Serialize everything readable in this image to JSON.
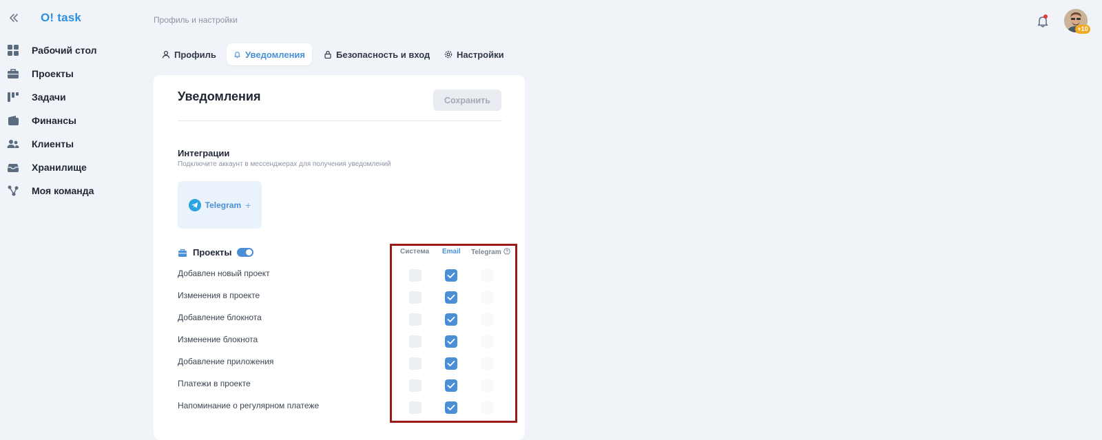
{
  "app": {
    "logo": "O! task"
  },
  "sidebar": {
    "items": [
      {
        "label": "Рабочий стол",
        "icon": "dashboard-icon"
      },
      {
        "label": "Проекты",
        "icon": "briefcase-icon"
      },
      {
        "label": "Задачи",
        "icon": "tasks-icon"
      },
      {
        "label": "Финансы",
        "icon": "wallet-icon"
      },
      {
        "label": "Клиенты",
        "icon": "users-icon"
      },
      {
        "label": "Хранилище",
        "icon": "storage-icon"
      },
      {
        "label": "Моя команда",
        "icon": "team-icon"
      }
    ]
  },
  "header": {
    "breadcrumb": "Профиль и настройки",
    "avatar_badge": "+10"
  },
  "tabs": [
    {
      "label": "Профиль",
      "icon": "user-icon",
      "active": false
    },
    {
      "label": "Уведомления",
      "icon": "bell-icon",
      "active": true
    },
    {
      "label": "Безопасность и вход",
      "icon": "lock-icon",
      "active": false
    },
    {
      "label": "Настройки",
      "icon": "gear-icon",
      "active": false
    }
  ],
  "notifications": {
    "title": "Уведомления",
    "save_label": "Сохранить",
    "integrations": {
      "title": "Интеграции",
      "subtitle": "Подключите аккаунт в мессенджерах для получения уведомлений",
      "telegram_label": "Telegram",
      "telegram_add": "+"
    },
    "projects": {
      "label": "Проекты",
      "enabled": true,
      "columns": [
        "Система",
        "Email",
        "Telegram"
      ],
      "rows": [
        {
          "label": "Добавлен новый проект",
          "system": false,
          "email": true,
          "telegram": false
        },
        {
          "label": "Изменения в проекте",
          "system": false,
          "email": true,
          "telegram": false
        },
        {
          "label": "Добавление блокнота",
          "system": false,
          "email": true,
          "telegram": false
        },
        {
          "label": "Изменение блокнота",
          "system": false,
          "email": true,
          "telegram": false
        },
        {
          "label": "Добавление приложения",
          "system": false,
          "email": true,
          "telegram": false
        },
        {
          "label": "Платежи в проекте",
          "system": false,
          "email": true,
          "telegram": false
        },
        {
          "label": "Напоминание о регулярном платеже",
          "system": false,
          "email": true,
          "telegram": false
        }
      ]
    }
  },
  "colors": {
    "accent": "#4a8fd6",
    "logo": "#2d8fe0",
    "highlight": "#9b1b1b"
  }
}
